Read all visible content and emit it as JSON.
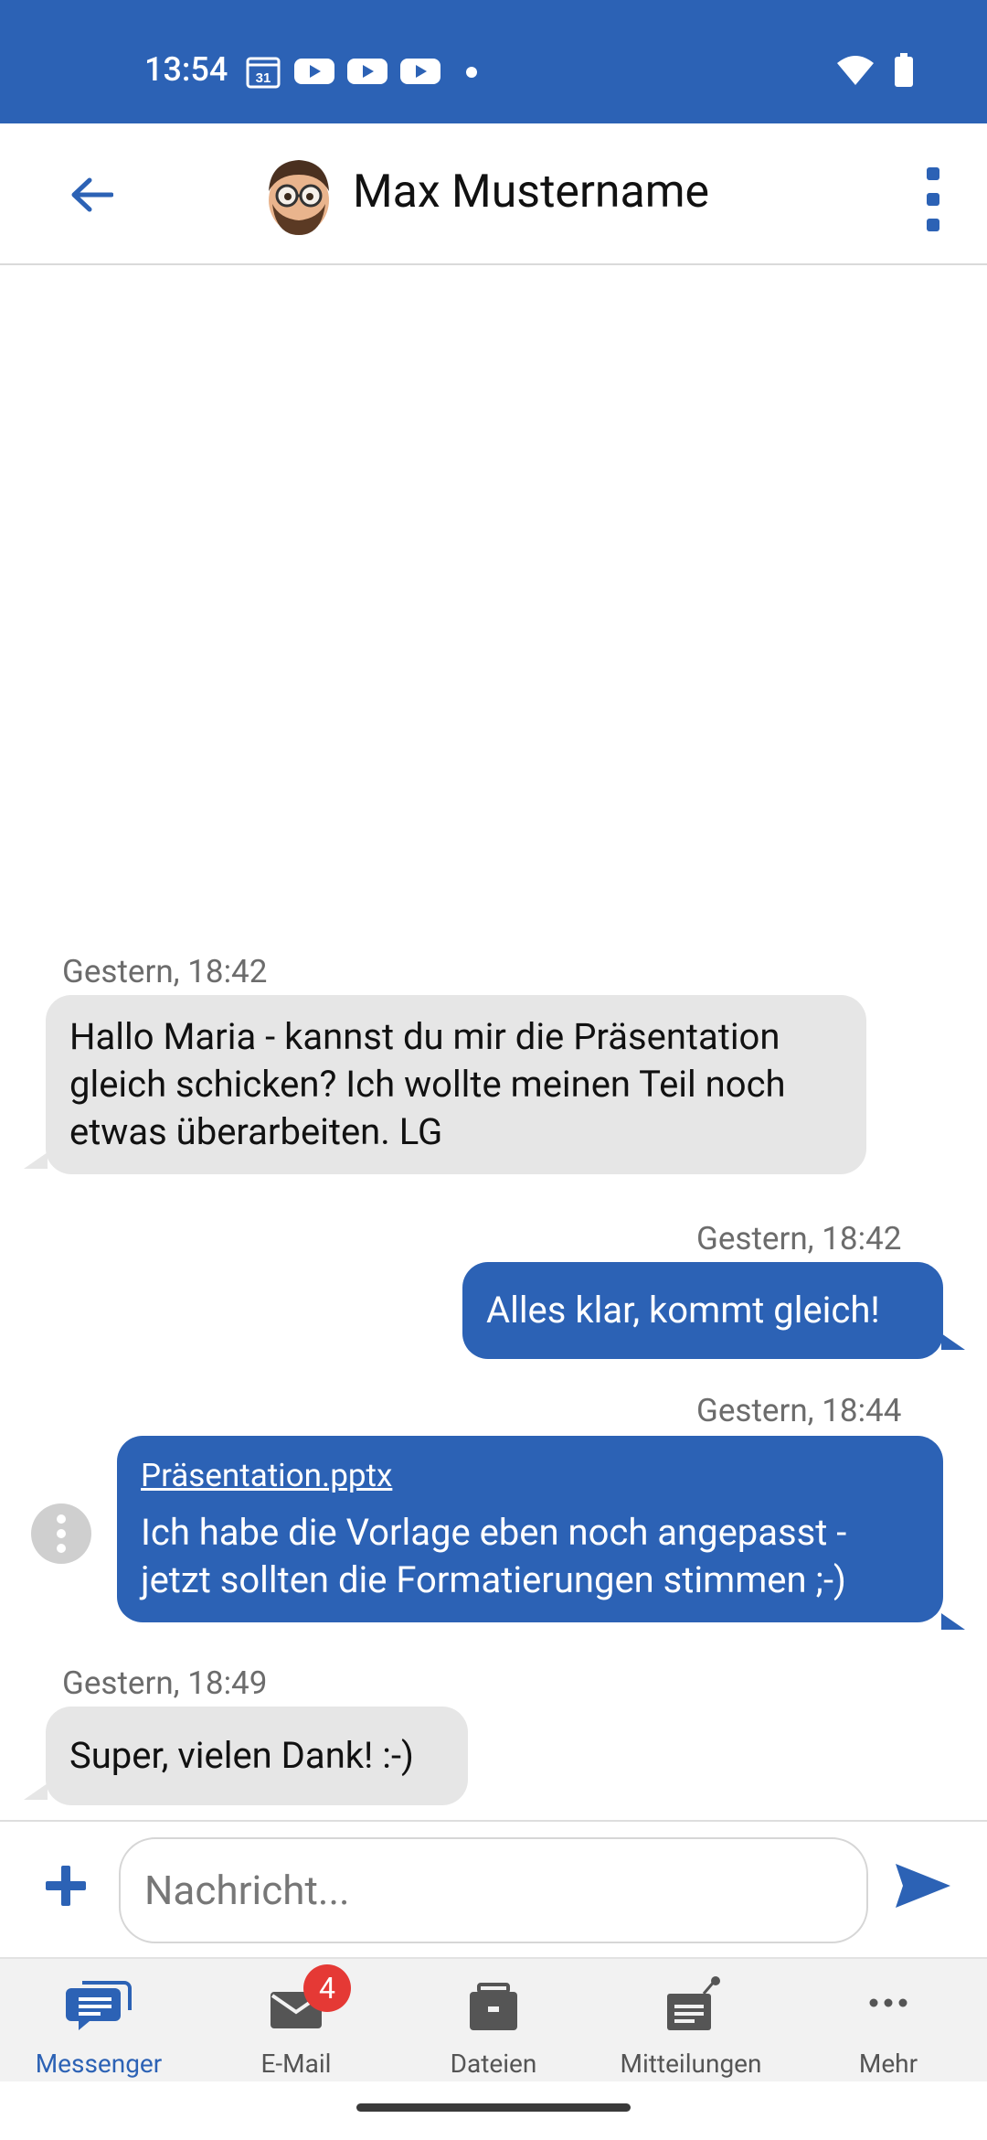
{
  "status_bar": {
    "time": "13:54",
    "calendar_day": "31"
  },
  "header": {
    "contact_name": "Max Mustername"
  },
  "messages": [
    {
      "direction": "incoming",
      "timestamp": "Gestern, 18:42",
      "text": "Hallo Maria - kannst du mir die Präsentation gleich schicken? Ich wollte meinen Teil noch etwas überarbeiten. LG"
    },
    {
      "direction": "outgoing",
      "timestamp": "Gestern, 18:42",
      "text": "Alles klar, kommt gleich!"
    },
    {
      "direction": "outgoing",
      "timestamp": "Gestern, 18:44",
      "attachment": "Präsentation.pptx",
      "text": "Ich habe die Vorlage eben noch angepasst - jetzt sollten die Formatierungen stimmen ;-)"
    },
    {
      "direction": "incoming",
      "timestamp": "Gestern, 18:49",
      "text": "Super, vielen Dank! :-)"
    }
  ],
  "composer": {
    "placeholder": "Nachricht..."
  },
  "nav": [
    {
      "label": "Messenger",
      "icon": "messenger-icon",
      "active": true
    },
    {
      "label": "E-Mail",
      "icon": "mail-icon",
      "badge": "4"
    },
    {
      "label": "Dateien",
      "icon": "briefcase-icon"
    },
    {
      "label": "Mitteilungen",
      "icon": "notifications-icon"
    },
    {
      "label": "Mehr",
      "icon": "more-horizontal-icon"
    }
  ],
  "colors": {
    "primary": "#2c62b5",
    "incoming_bubble": "#e6e6e6",
    "badge": "#e53935"
  }
}
